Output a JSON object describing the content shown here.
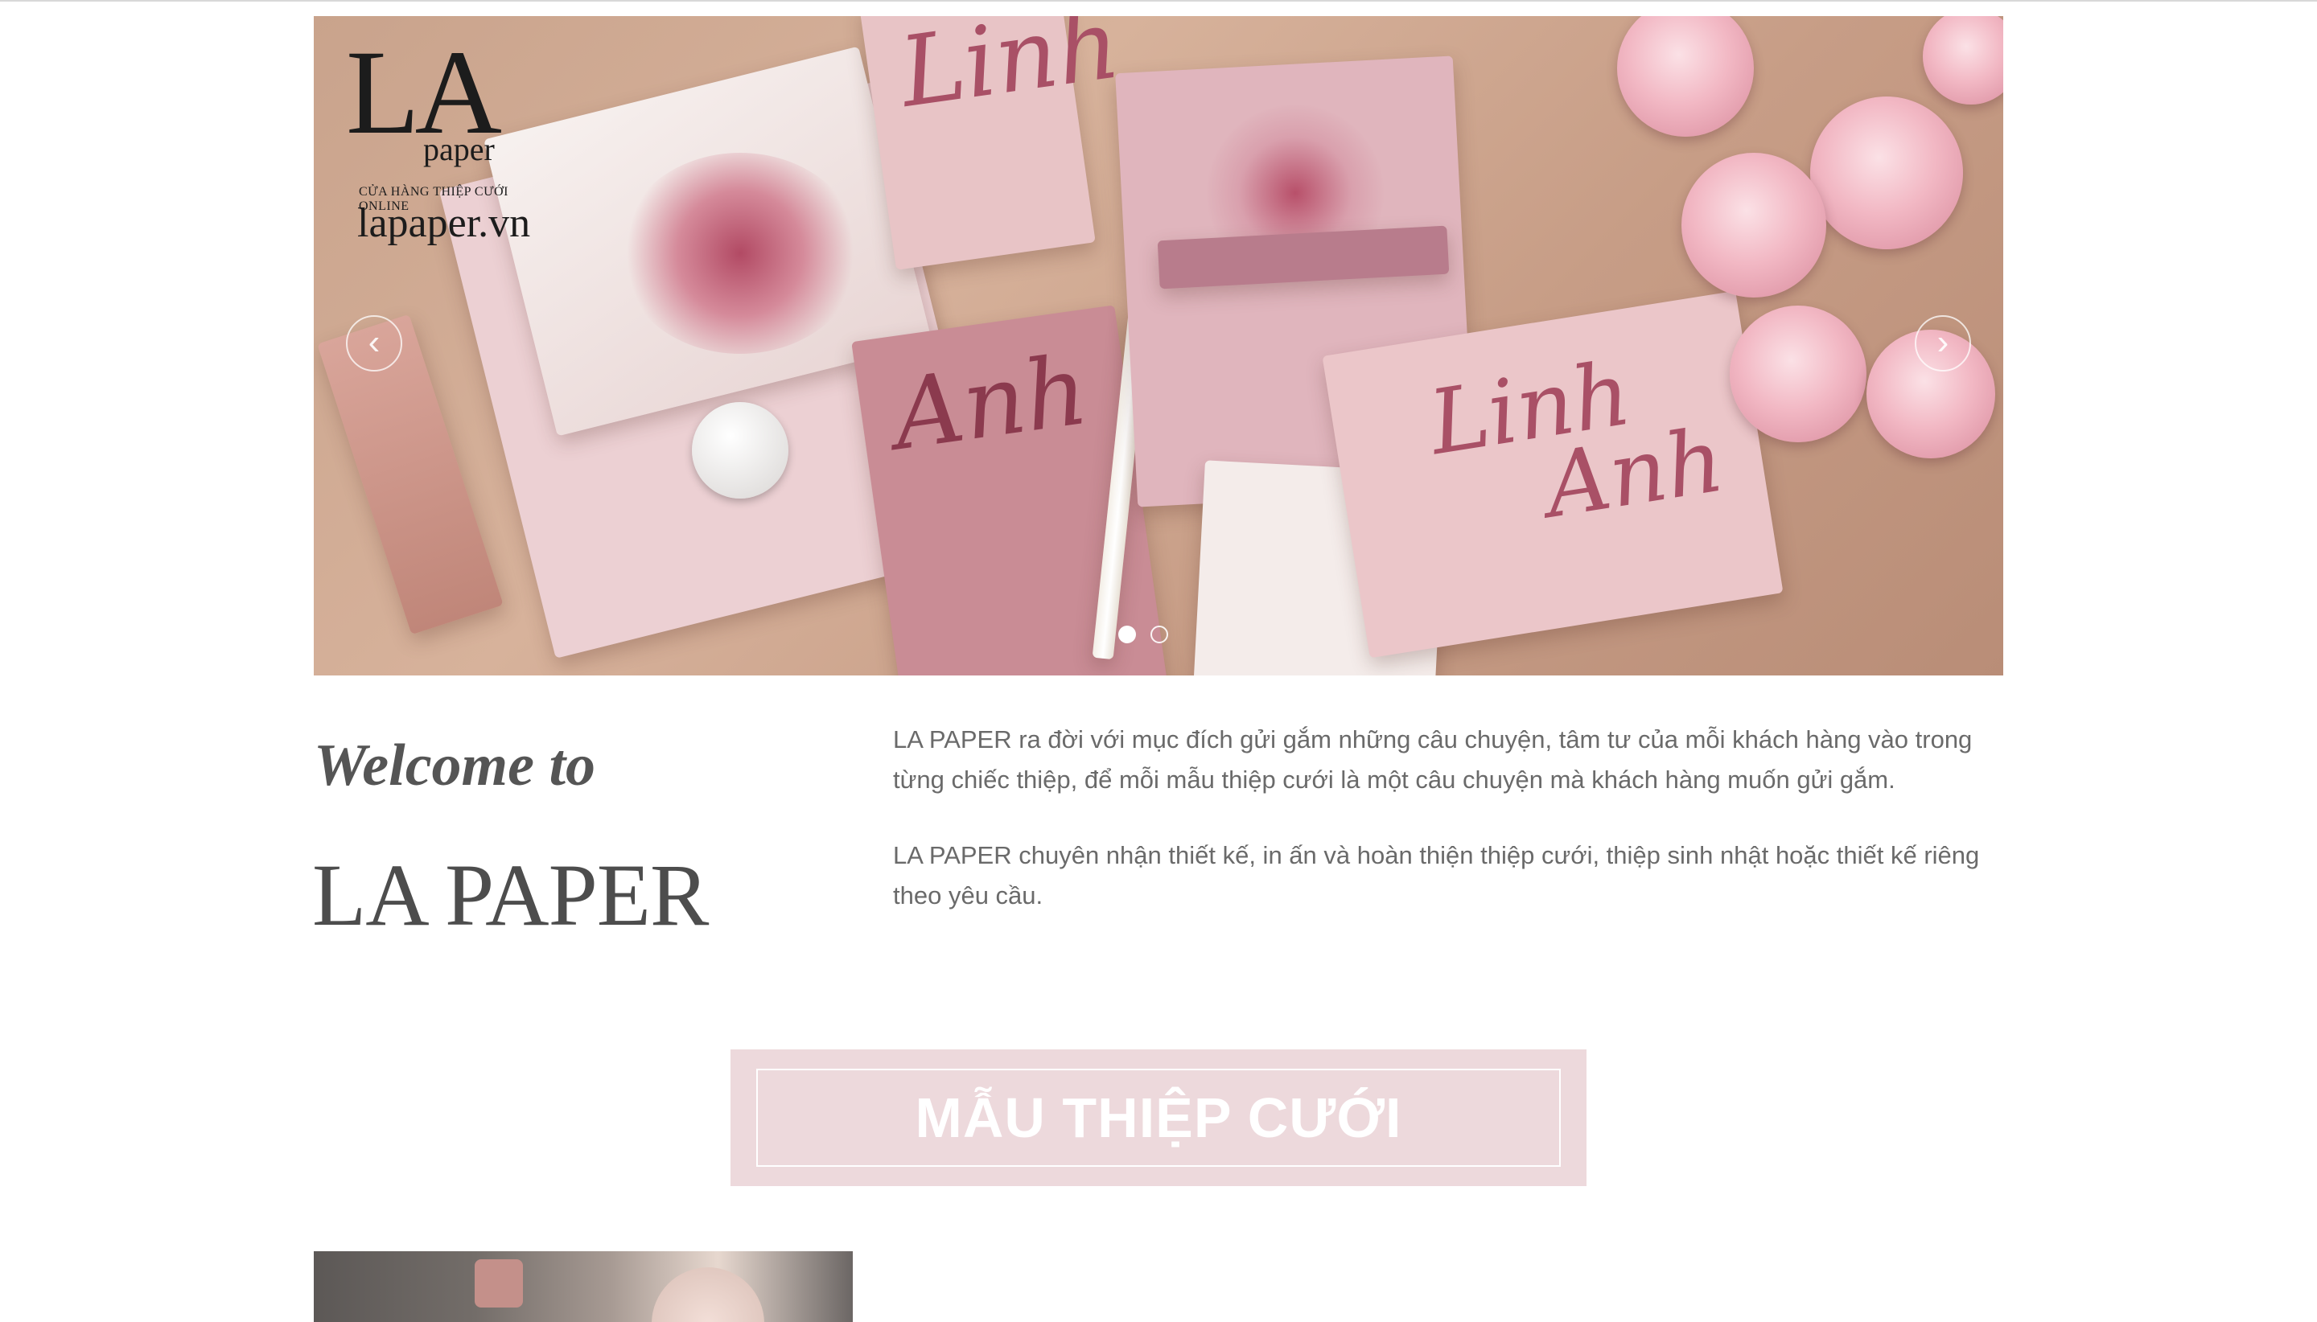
{
  "hero": {
    "logo": {
      "mark": "LA",
      "word": "paper",
      "tagline": "CỬA HÀNG THIỆP CƯỚI ONLINE",
      "site": "lapaper.vn"
    },
    "card_names": [
      "Linh",
      "Anh"
    ],
    "prev_icon": "‹",
    "next_icon": "›",
    "slides": 2,
    "active_slide": 1
  },
  "welcome": {
    "heading": "Welcome to",
    "brand": "LA PAPER",
    "paragraphs": [
      "LA PAPER ra đời với mục đích gửi gắm những câu chuyện, tâm tư của mỗi khách hàng vào trong từng chiếc thiệp, để mỗi mẫu thiệp cưới là một câu chuyện mà khách hàng muốn gửi gắm.",
      "LA PAPER chuyên nhận thiết kế, in ấn và hoàn thiện thiệp cưới, thiệp sinh nhật hoặc thiết kế riêng theo yêu cầu."
    ]
  },
  "section": {
    "button_label": "MẪU THIỆP CƯỚI"
  },
  "colors": {
    "section_bg": "#edd9dc",
    "text": "#6a6a6a",
    "heading": "#555555"
  }
}
